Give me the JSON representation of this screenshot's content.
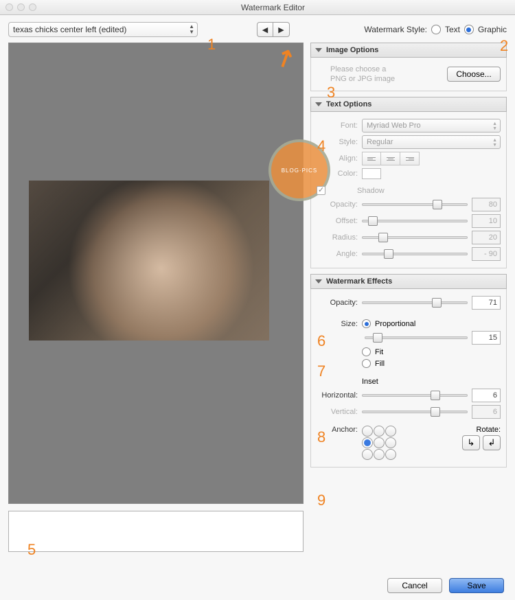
{
  "window": {
    "title": "Watermark Editor"
  },
  "preset": {
    "name": "texas chicks center left (edited)"
  },
  "style": {
    "label": "Watermark Style:",
    "text_label": "Text",
    "graphic_label": "Graphic",
    "selected": "Graphic"
  },
  "annotations": {
    "a1": "1",
    "a2": "2",
    "a3": "3",
    "a4": "4",
    "a5": "5",
    "a6": "6",
    "a7": "7",
    "a8": "8",
    "a9": "9"
  },
  "sections": {
    "image": {
      "title": "Image Options",
      "prompt_line1": "Please choose a",
      "prompt_line2": "PNG or JPG image",
      "choose_label": "Choose..."
    },
    "text": {
      "title": "Text Options",
      "font_label": "Font:",
      "font_value": "Myriad Web Pro",
      "style_label": "Style:",
      "style_value": "Regular",
      "align_label": "Align:",
      "color_label": "Color:",
      "shadow_label": "Shadow",
      "opacity_label": "Opacity:",
      "opacity_value": "80",
      "offset_label": "Offset:",
      "offset_value": "10",
      "radius_label": "Radius:",
      "radius_value": "20",
      "angle_label": "Angle:",
      "angle_value": "- 90"
    },
    "effects": {
      "title": "Watermark Effects",
      "opacity_label": "Opacity:",
      "opacity_value": "71",
      "size_label": "Size:",
      "proportional_label": "Proportional",
      "proportional_value": "15",
      "fit_label": "Fit",
      "fill_label": "Fill",
      "inset_label": "Inset",
      "horizontal_label": "Horizontal:",
      "horizontal_value": "6",
      "vertical_label": "Vertical:",
      "vertical_value": "6",
      "anchor_label": "Anchor:",
      "rotate_label": "Rotate:"
    }
  },
  "footer": {
    "cancel": "Cancel",
    "save": "Save"
  }
}
